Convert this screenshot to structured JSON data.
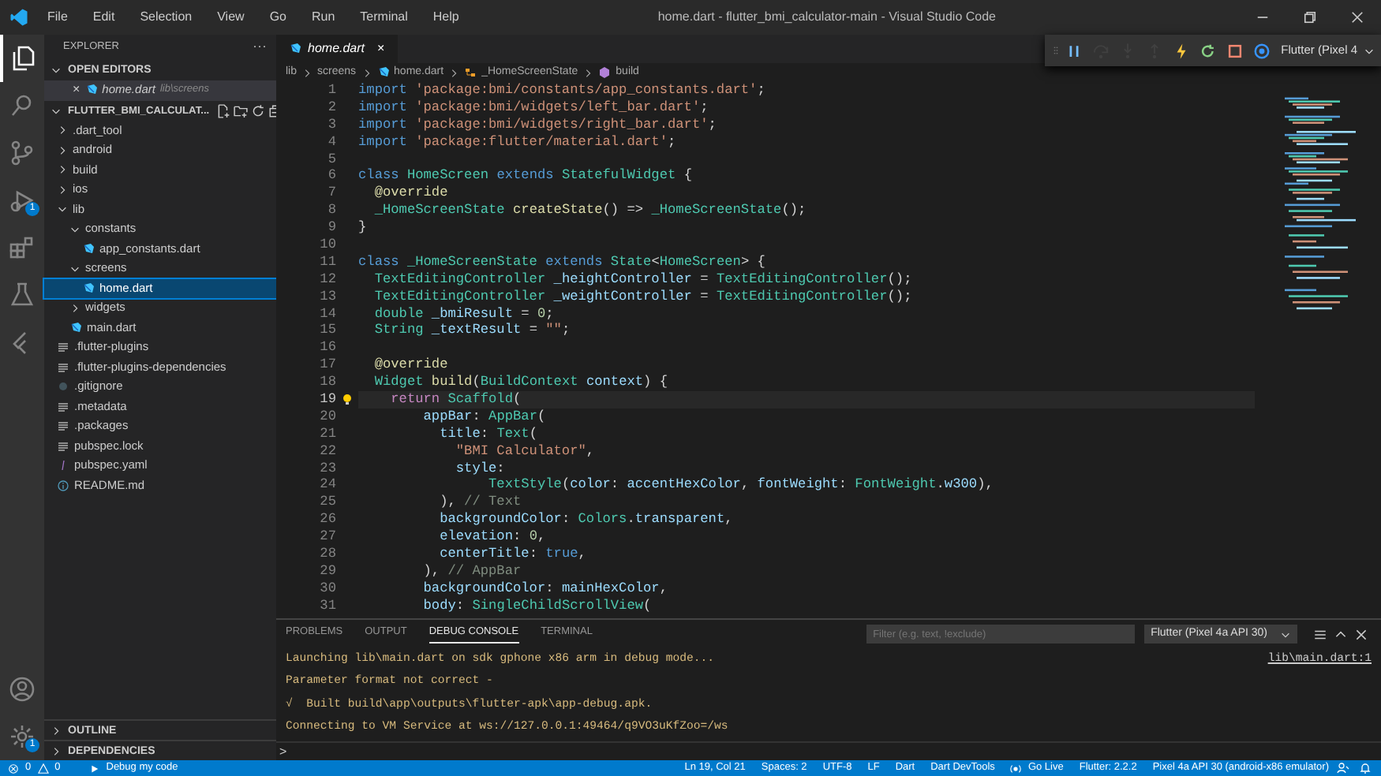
{
  "title_bar": {
    "menu": [
      "File",
      "Edit",
      "Selection",
      "View",
      "Go",
      "Run",
      "Terminal",
      "Help"
    ],
    "title": "home.dart - flutter_bmi_calculator-main - Visual Studio Code"
  },
  "activity_bar": [
    {
      "kind": "files",
      "selected": true
    },
    {
      "kind": "search",
      "selected": false
    },
    {
      "kind": "source-control",
      "selected": false
    },
    {
      "kind": "run",
      "selected": false,
      "badge": "1"
    },
    {
      "kind": "extensions",
      "selected": false
    },
    {
      "kind": "testing",
      "selected": false
    },
    {
      "kind": "flutter",
      "selected": false
    },
    {
      "kind": "account",
      "selected": false
    },
    {
      "kind": "settings",
      "selected": false,
      "badge": "1"
    }
  ],
  "sidebar": {
    "title": "EXPLORER",
    "more": "···",
    "open_editors": {
      "label": "OPEN EDITORS",
      "expanded": true,
      "files": [
        {
          "name": "home.dart",
          "path": "lib\\screens",
          "close": "×"
        }
      ]
    },
    "folder": {
      "label": "FLUTTER_BMI_CALCULAT...",
      "expanded": true,
      "items": [
        {
          "name": ".dart_tool",
          "kind": "folder",
          "expanded": false,
          "selected": false
        },
        {
          "name": "android",
          "kind": "folder",
          "expanded": false,
          "selected": false
        },
        {
          "name": "build",
          "kind": "folder",
          "expanded": false,
          "selected": false
        },
        {
          "name": "ios",
          "kind": "folder",
          "expanded": false,
          "selected": false
        },
        {
          "name": "lib",
          "kind": "folder",
          "expanded": true,
          "selected": false,
          "children": [
            {
              "name": "constants",
              "kind": "folder",
              "expanded": true,
              "selected": false,
              "children": [
                {
                  "name": "app_constants.dart",
                  "kind": "dart",
                  "selected": false
                }
              ]
            },
            {
              "name": "screens",
              "kind": "folder",
              "expanded": true,
              "selected": false,
              "children": [
                {
                  "name": "home.dart",
                  "kind": "dart",
                  "selected": true
                }
              ]
            },
            {
              "name": "widgets",
              "kind": "folder",
              "expanded": false,
              "selected": false
            },
            {
              "name": "main.dart",
              "kind": "dart",
              "selected": false
            }
          ]
        },
        {
          "name": ".flutter-plugins",
          "kind": "text",
          "selected": false
        },
        {
          "name": ".flutter-plugins-dependencies",
          "kind": "text",
          "selected": false
        },
        {
          "name": ".gitignore",
          "kind": "git",
          "selected": false
        },
        {
          "name": ".metadata",
          "kind": "text",
          "selected": false
        },
        {
          "name": ".packages",
          "kind": "text",
          "selected": false
        },
        {
          "name": "pubspec.lock",
          "kind": "text",
          "selected": false
        },
        {
          "name": "pubspec.yaml",
          "kind": "yaml",
          "selected": false
        },
        {
          "name": "README.md",
          "kind": "info",
          "selected": false
        }
      ]
    },
    "sections": [
      {
        "label": "OUTLINE",
        "expanded": false
      },
      {
        "label": "DEPENDENCIES",
        "expanded": false
      }
    ]
  },
  "tabs": [
    {
      "label": "home.dart",
      "selected": true,
      "close": "×"
    }
  ],
  "debug_toolbar": {
    "buttons": [
      {
        "kind": "pause",
        "disabled": false
      },
      {
        "kind": "step-over",
        "disabled": true
      },
      {
        "kind": "step-into",
        "disabled": true
      },
      {
        "kind": "step-out",
        "disabled": true
      },
      {
        "kind": "hot-reload",
        "disabled": false
      },
      {
        "kind": "restart",
        "disabled": false
      },
      {
        "kind": "stop",
        "disabled": false
      },
      {
        "kind": "devtools",
        "disabled": false
      }
    ],
    "device": "Flutter (Pixel 4"
  },
  "window_controls": [
    {
      "kind": "minimize"
    },
    {
      "kind": "restore"
    },
    {
      "kind": "close"
    }
  ],
  "breadcrumb": [
    {
      "label": "lib",
      "kind": "text"
    },
    {
      "label": "screens",
      "kind": "text"
    },
    {
      "label": "home.dart",
      "kind": "dart"
    },
    {
      "label": "_HomeScreenState",
      "kind": "class"
    },
    {
      "label": "build",
      "kind": "method"
    }
  ],
  "code": [
    {
      "number": "1",
      "current": false,
      "tokens": [
        {
          "kind": "k",
          "text": "import "
        },
        {
          "kind": "s",
          "text": "'package:bmi/constants/app_constants.dart'"
        },
        {
          "kind": "p",
          "text": ";"
        }
      ]
    },
    {
      "number": "2",
      "current": false,
      "tokens": [
        {
          "kind": "k",
          "text": "import "
        },
        {
          "kind": "s",
          "text": "'package:bmi/widgets/left_bar.dart'"
        },
        {
          "kind": "p",
          "text": ";"
        }
      ]
    },
    {
      "number": "3",
      "current": false,
      "tokens": [
        {
          "kind": "k",
          "text": "import "
        },
        {
          "kind": "s",
          "text": "'package:bmi/widgets/right_bar.dart'"
        },
        {
          "kind": "p",
          "text": ";"
        }
      ]
    },
    {
      "number": "4",
      "current": false,
      "tokens": [
        {
          "kind": "k",
          "text": "import "
        },
        {
          "kind": "s",
          "text": "'package:flutter/material.dart'"
        },
        {
          "kind": "p",
          "text": ";"
        }
      ]
    },
    {
      "number": "5",
      "current": false
    },
    {
      "number": "6",
      "current": false,
      "tokens": [
        {
          "kind": "k",
          "text": "class "
        },
        {
          "kind": "t",
          "text": "HomeScreen "
        },
        {
          "kind": "k",
          "text": "extends "
        },
        {
          "kind": "t",
          "text": "StatefulWidget"
        },
        {
          "kind": "p",
          "text": " {"
        }
      ]
    },
    {
      "number": "7",
      "current": false,
      "tokens": [
        {
          "kind": "f",
          "text": "  @override"
        }
      ]
    },
    {
      "number": "8",
      "current": false,
      "tokens": [
        {
          "kind": "t",
          "text": "  _HomeScreenState "
        },
        {
          "kind": "f",
          "text": "createState"
        },
        {
          "kind": "p",
          "text": "() => "
        },
        {
          "kind": "t",
          "text": "_HomeScreenState"
        },
        {
          "kind": "p",
          "text": "();"
        }
      ]
    },
    {
      "number": "9",
      "current": false,
      "tokens": [
        {
          "kind": "p",
          "text": "}"
        }
      ]
    },
    {
      "number": "10",
      "current": false
    },
    {
      "number": "11",
      "current": false,
      "tokens": [
        {
          "kind": "k",
          "text": "class "
        },
        {
          "kind": "t",
          "text": "_HomeScreenState "
        },
        {
          "kind": "k",
          "text": "extends "
        },
        {
          "kind": "t",
          "text": "State"
        },
        {
          "kind": "p",
          "text": "<"
        },
        {
          "kind": "t",
          "text": "HomeScreen"
        },
        {
          "kind": "p",
          "text": "> {"
        }
      ]
    },
    {
      "number": "12",
      "current": false,
      "tokens": [
        {
          "kind": "t",
          "text": "  TextEditingController "
        },
        {
          "kind": "v",
          "text": "_heightController"
        },
        {
          "kind": "p",
          "text": " = "
        },
        {
          "kind": "t",
          "text": "TextEditingController"
        },
        {
          "kind": "p",
          "text": "();"
        }
      ]
    },
    {
      "number": "13",
      "current": false,
      "tokens": [
        {
          "kind": "t",
          "text": "  TextEditingController "
        },
        {
          "kind": "v",
          "text": "_weightController"
        },
        {
          "kind": "p",
          "text": " = "
        },
        {
          "kind": "t",
          "text": "TextEditingController"
        },
        {
          "kind": "p",
          "text": "();"
        }
      ]
    },
    {
      "number": "14",
      "current": false,
      "tokens": [
        {
          "kind": "t",
          "text": "  double "
        },
        {
          "kind": "v",
          "text": "_bmiResult"
        },
        {
          "kind": "p",
          "text": " = "
        },
        {
          "kind": "n",
          "text": "0"
        },
        {
          "kind": "p",
          "text": ";"
        }
      ]
    },
    {
      "number": "15",
      "current": false,
      "tokens": [
        {
          "kind": "t",
          "text": "  String "
        },
        {
          "kind": "v",
          "text": "_textResult"
        },
        {
          "kind": "p",
          "text": " = "
        },
        {
          "kind": "s",
          "text": "\"\""
        },
        {
          "kind": "p",
          "text": ";"
        }
      ]
    },
    {
      "number": "16",
      "current": false
    },
    {
      "number": "17",
      "current": false,
      "tokens": [
        {
          "kind": "f",
          "text": "  @override"
        }
      ]
    },
    {
      "number": "18",
      "current": false,
      "tokens": [
        {
          "kind": "t",
          "text": "  Widget "
        },
        {
          "kind": "f",
          "text": "build"
        },
        {
          "kind": "p",
          "text": "("
        },
        {
          "kind": "t",
          "text": "BuildContext "
        },
        {
          "kind": "v",
          "text": "context"
        },
        {
          "kind": "p",
          "text": ") {"
        }
      ]
    },
    {
      "number": "19",
      "current": true,
      "tokens": [
        {
          "kind": "c",
          "text": "    return "
        },
        {
          "kind": "t",
          "text": "Scaffold"
        },
        {
          "kind": "p",
          "text": "("
        }
      ]
    },
    {
      "number": "20",
      "current": false,
      "tokens": [
        {
          "kind": "v",
          "text": "        appBar"
        },
        {
          "kind": "p",
          "text": ": "
        },
        {
          "kind": "t",
          "text": "AppBar"
        },
        {
          "kind": "p",
          "text": "("
        }
      ]
    },
    {
      "number": "21",
      "current": false,
      "tokens": [
        {
          "kind": "v",
          "text": "          title"
        },
        {
          "kind": "p",
          "text": ": "
        },
        {
          "kind": "t",
          "text": "Text"
        },
        {
          "kind": "p",
          "text": "("
        }
      ]
    },
    {
      "number": "22",
      "current": false,
      "tokens": [
        {
          "kind": "s",
          "text": "            \"BMI Calculator\""
        },
        {
          "kind": "p",
          "text": ","
        }
      ]
    },
    {
      "number": "23",
      "current": false,
      "tokens": [
        {
          "kind": "v",
          "text": "            style"
        },
        {
          "kind": "p",
          "text": ":"
        }
      ]
    },
    {
      "number": "24",
      "current": false,
      "tokens": [
        {
          "kind": "t",
          "text": "                TextStyle"
        },
        {
          "kind": "p",
          "text": "("
        },
        {
          "kind": "v",
          "text": "color"
        },
        {
          "kind": "p",
          "text": ": "
        },
        {
          "kind": "v",
          "text": "accentHexColor"
        },
        {
          "kind": "p",
          "text": ", "
        },
        {
          "kind": "v",
          "text": "fontWeight"
        },
        {
          "kind": "p",
          "text": ": "
        },
        {
          "kind": "t",
          "text": "FontWeight"
        },
        {
          "kind": "p",
          "text": "."
        },
        {
          "kind": "v",
          "text": "w300"
        },
        {
          "kind": "p",
          "text": "),"
        }
      ]
    },
    {
      "number": "25",
      "current": false,
      "tokens": [
        {
          "kind": "p",
          "text": "          ), "
        },
        {
          "kind": "m",
          "text": "// Text"
        }
      ]
    },
    {
      "number": "26",
      "current": false,
      "tokens": [
        {
          "kind": "v",
          "text": "          backgroundColor"
        },
        {
          "kind": "p",
          "text": ": "
        },
        {
          "kind": "t",
          "text": "Colors"
        },
        {
          "kind": "p",
          "text": "."
        },
        {
          "kind": "v",
          "text": "transparent"
        },
        {
          "kind": "p",
          "text": ","
        }
      ]
    },
    {
      "number": "27",
      "current": false,
      "tokens": [
        {
          "kind": "v",
          "text": "          elevation"
        },
        {
          "kind": "p",
          "text": ": "
        },
        {
          "kind": "n",
          "text": "0"
        },
        {
          "kind": "p",
          "text": ","
        }
      ]
    },
    {
      "number": "28",
      "current": false,
      "tokens": [
        {
          "kind": "v",
          "text": "          centerTitle"
        },
        {
          "kind": "p",
          "text": ": "
        },
        {
          "kind": "k",
          "text": "true"
        },
        {
          "kind": "p",
          "text": ","
        }
      ]
    },
    {
      "number": "29",
      "current": false,
      "tokens": [
        {
          "kind": "p",
          "text": "        ), "
        },
        {
          "kind": "m",
          "text": "// AppBar"
        }
      ]
    },
    {
      "number": "30",
      "current": false,
      "tokens": [
        {
          "kind": "v",
          "text": "        backgroundColor"
        },
        {
          "kind": "p",
          "text": ": "
        },
        {
          "kind": "v",
          "text": "mainHexColor"
        },
        {
          "kind": "p",
          "text": ","
        }
      ]
    },
    {
      "number": "31",
      "current": false,
      "tokens": [
        {
          "kind": "v",
          "text": "        body"
        },
        {
          "kind": "p",
          "text": ": "
        },
        {
          "kind": "t",
          "text": "SingleChildScrollView"
        },
        {
          "kind": "p",
          "text": "("
        }
      ]
    }
  ],
  "panel": {
    "tabs": [
      {
        "label": "PROBLEMS",
        "selected": false
      },
      {
        "label": "OUTPUT",
        "selected": false
      },
      {
        "label": "DEBUG CONSOLE",
        "selected": true
      },
      {
        "label": "TERMINAL",
        "selected": false
      }
    ],
    "filter": {
      "placeholder": "Filter (e.g. text, !exclude)"
    },
    "session": "Flutter (Pixel 4a API 30)",
    "console": [
      {
        "text": "Launching lib\\main.dart on sdk gphone x86 arm in debug mode...",
        "source": "lib\\main.dart:1"
      },
      {
        "text": "Parameter format not correct -"
      },
      {
        "text": "√  Built build\\app\\outputs\\flutter-apk\\app-debug.apk."
      },
      {
        "text": "Connecting to VM Service at ws://127.0.0.1:49464/q9VO3uKfZoo=/ws"
      }
    ],
    "prompt": ">"
  },
  "status_bar": {
    "errors": "0",
    "warnings": "0",
    "debug": "Debug my code",
    "right": [
      {
        "label": "Ln 19, Col 21",
        "kind": "text"
      },
      {
        "label": "Spaces: 2",
        "kind": "text"
      },
      {
        "label": "UTF-8",
        "kind": "text"
      },
      {
        "label": "LF",
        "kind": "text"
      },
      {
        "label": "Dart",
        "kind": "text"
      },
      {
        "label": "Dart DevTools",
        "kind": "text"
      },
      {
        "label": "Go Live",
        "kind": "live"
      },
      {
        "label": "Flutter: 2.2.2",
        "kind": "text"
      },
      {
        "label": "Pixel 4a API 30 (android-x86 emulator)",
        "kind": "text"
      }
    ]
  }
}
